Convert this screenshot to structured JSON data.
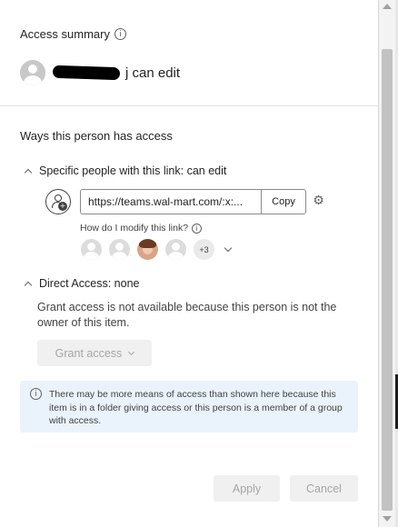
{
  "summary": {
    "title": "Access summary",
    "person_label": "j can edit"
  },
  "ways": {
    "title": "Ways this person has access"
  },
  "specific": {
    "heading": "Specific people with this link: can edit",
    "url": "https://teams.wal-mart.com/:x:...",
    "copy_label": "Copy",
    "modify_text": "How do I modify this link?",
    "more_count": "+3",
    "avatars": [
      "user-avatar",
      "user-avatar",
      "photo-avatar",
      "user-avatar"
    ]
  },
  "direct": {
    "heading": "Direct Access: none",
    "message": "Grant access is not available because this person is not the owner of this item.",
    "grant_label": "Grant access"
  },
  "notice": {
    "text": "There may be more means of access than shown here because this item is in a folder giving access or this person is a member of a group with access."
  },
  "footer": {
    "apply_label": "Apply",
    "cancel_label": "Cancel"
  },
  "colors": {
    "notice_background": "#eaf3fb",
    "disabled_text": "#a6a6a6",
    "disabled_background": "#f0f0f0"
  }
}
